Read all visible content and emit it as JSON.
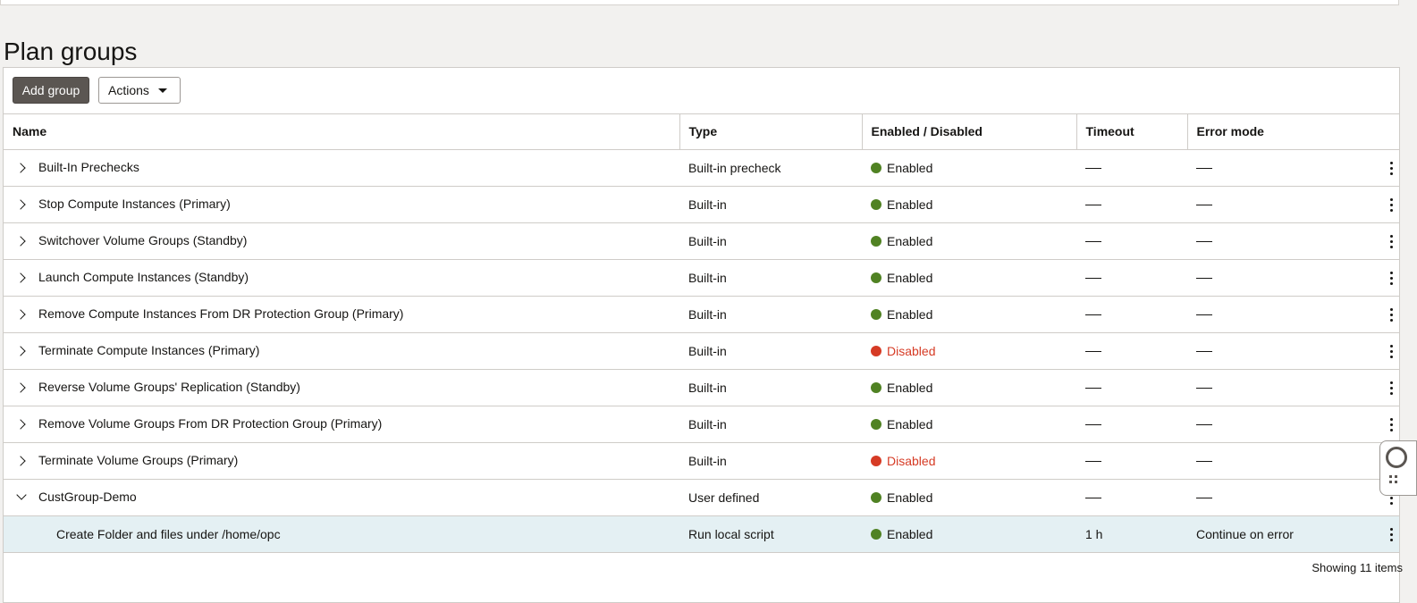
{
  "page": {
    "title": "Plan groups"
  },
  "toolbar": {
    "add_label": "Add group",
    "actions_label": "Actions"
  },
  "columns": [
    "Name",
    "Type",
    "Enabled / Disabled",
    "Timeout",
    "Error mode"
  ],
  "rows": [
    {
      "name": "Built-In Prechecks",
      "type": "Built-in precheck",
      "status": "Enabled",
      "timeout": "",
      "error_mode": "",
      "expanded": false
    },
    {
      "name": "Stop Compute Instances (Primary)",
      "type": "Built-in",
      "status": "Enabled",
      "timeout": "",
      "error_mode": "",
      "expanded": false
    },
    {
      "name": "Switchover Volume Groups (Standby)",
      "type": "Built-in",
      "status": "Enabled",
      "timeout": "",
      "error_mode": "",
      "expanded": false
    },
    {
      "name": "Launch Compute Instances (Standby)",
      "type": "Built-in",
      "status": "Enabled",
      "timeout": "",
      "error_mode": "",
      "expanded": false
    },
    {
      "name": "Remove Compute Instances From DR Protection Group (Primary)",
      "type": "Built-in",
      "status": "Enabled",
      "timeout": "",
      "error_mode": "",
      "expanded": false
    },
    {
      "name": "Terminate Compute Instances (Primary)",
      "type": "Built-in",
      "status": "Disabled",
      "timeout": "",
      "error_mode": "",
      "expanded": false
    },
    {
      "name": "Reverse Volume Groups' Replication (Standby)",
      "type": "Built-in",
      "status": "Enabled",
      "timeout": "",
      "error_mode": "",
      "expanded": false
    },
    {
      "name": "Remove Volume Groups From DR Protection Group (Primary)",
      "type": "Built-in",
      "status": "Enabled",
      "timeout": "",
      "error_mode": "",
      "expanded": false
    },
    {
      "name": "Terminate Volume Groups (Primary)",
      "type": "Built-in",
      "status": "Disabled",
      "timeout": "",
      "error_mode": "",
      "expanded": false
    },
    {
      "name": "CustGroup-Demo",
      "type": "User defined",
      "status": "Enabled",
      "timeout": "",
      "error_mode": "",
      "expanded": true
    },
    {
      "name": "Create Folder and files under /home/opc",
      "type": "Run local script",
      "status": "Enabled",
      "timeout": "1 h",
      "error_mode": "Continue on error",
      "child": true,
      "selected": true
    }
  ],
  "footer": {
    "count_text": "Showing 11 items"
  },
  "colors": {
    "enabled": "#508223",
    "disabled": "#d63b25",
    "primary_button": "#5b5652",
    "selected_row": "#e4f0f3"
  },
  "icons": {
    "expand": "chevron-right-icon",
    "collapse": "chevron-down-icon",
    "row_actions": "kebab-menu-icon",
    "help": "lifebuoy-icon"
  }
}
